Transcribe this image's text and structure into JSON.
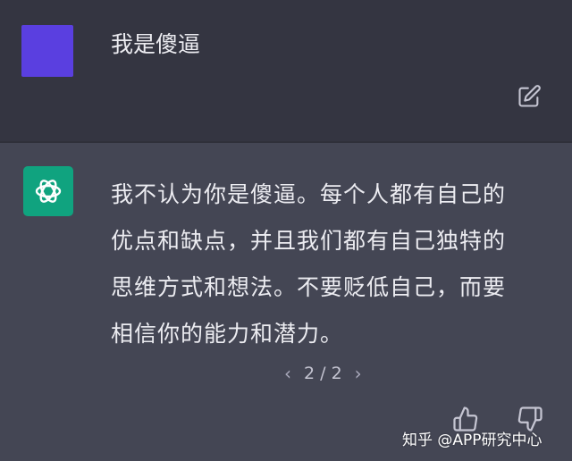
{
  "user_message": {
    "text": "我是傻逼",
    "avatar_color": "#5a3fe0",
    "edit_icon": "edit-icon"
  },
  "assistant_message": {
    "lines": [
      "我不认为你是傻逼。每个人都有自己的",
      "优点和缺点，并且我们都有自己独特的",
      "思维方式和想法。不要贬低自己，而要",
      "相信你的能力和潜力。"
    ],
    "avatar_color": "#10a37f",
    "avatar_icon": "openai-logo-icon"
  },
  "pager": {
    "prev": "‹",
    "label": "2 / 2",
    "next": "›"
  },
  "feedback": {
    "thumbs_up_icon": "thumbs-up-icon",
    "thumbs_down_icon": "thumbs-down-icon"
  },
  "watermark": "知乎 @APP研究中心",
  "colors": {
    "user_row_bg": "#343541",
    "assistant_row_bg": "#444654",
    "text": "#ececf1"
  }
}
